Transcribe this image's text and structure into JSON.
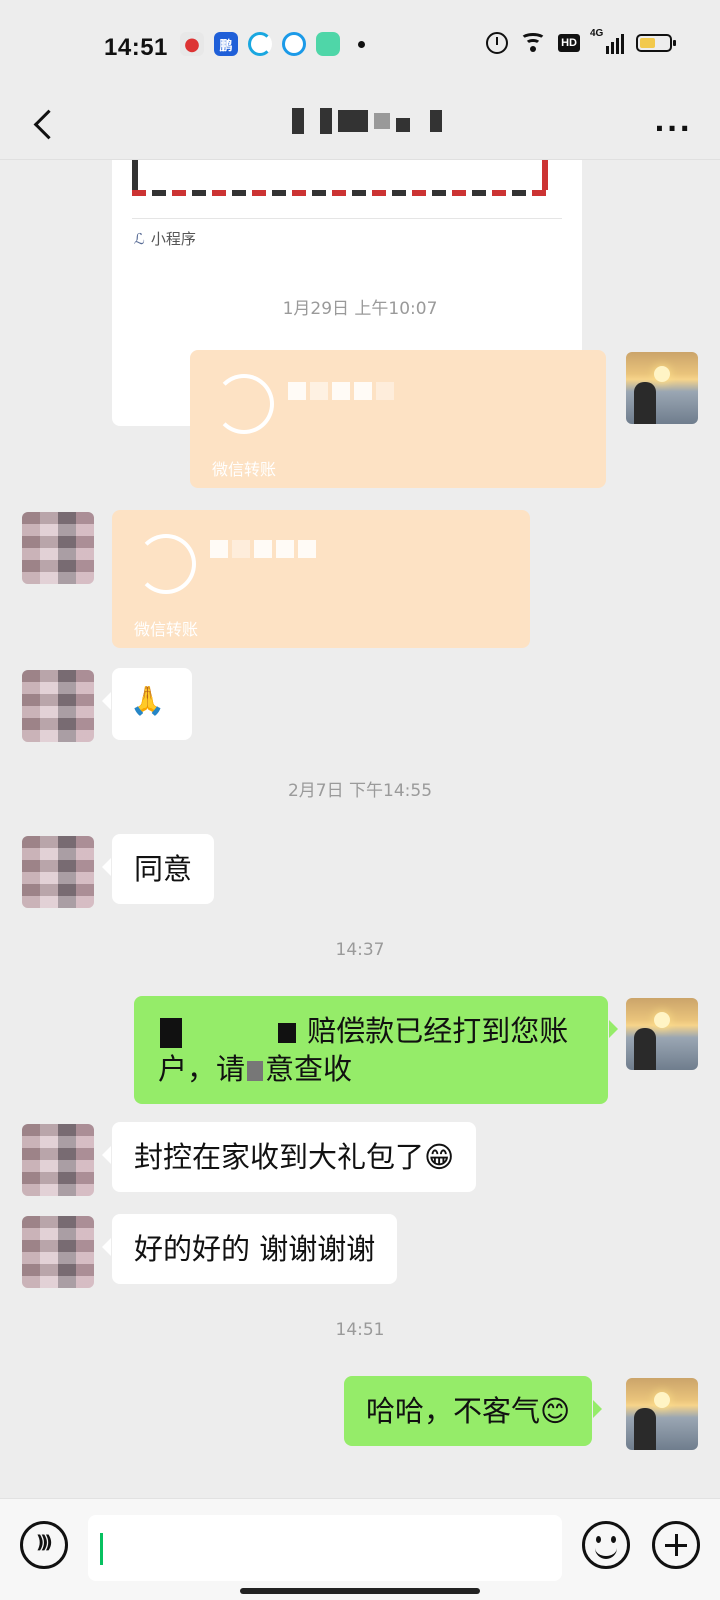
{
  "status_bar": {
    "time": "14:51",
    "network": "4G",
    "hd_label": "HD",
    "battery_level": 0.55
  },
  "header": {
    "back_icon": "chevron-left-icon",
    "more_icon": "more-dots-icon",
    "more_label": "···"
  },
  "mini_program_card": {
    "label": "小程序",
    "icon": "mini-program-icon"
  },
  "messages": [
    {
      "type": "timestamp",
      "text": "1月29日 上午10:07"
    },
    {
      "type": "transfer",
      "side": "right",
      "label": "微信转账"
    },
    {
      "type": "transfer",
      "side": "left",
      "label": "微信转账"
    },
    {
      "type": "emoji",
      "side": "left",
      "text": "🙏"
    },
    {
      "type": "timestamp",
      "text": "2月7日 下午14:55"
    },
    {
      "type": "text",
      "side": "left",
      "text": "同意"
    },
    {
      "type": "timestamp",
      "text": "14:37"
    },
    {
      "type": "text",
      "side": "right",
      "line1": "赔偿款已经打到您账",
      "line2_a": "户，请",
      "line2_b": "意查收"
    },
    {
      "type": "text",
      "side": "left",
      "text": "封控在家收到大礼包了😁"
    },
    {
      "type": "text",
      "side": "left",
      "text": "好的好的 谢谢谢谢"
    },
    {
      "type": "timestamp",
      "text": "14:51"
    },
    {
      "type": "text",
      "side": "right",
      "text": "哈哈，不客气😊"
    }
  ],
  "input_bar": {
    "voice_icon": "voice-icon",
    "emoji_icon": "emoji-icon",
    "plus_icon": "plus-icon",
    "value": ""
  },
  "colors": {
    "background": "#ededed",
    "green_bubble": "#95ec69",
    "transfer_bubble": "#fde2c4",
    "caret": "#07c160"
  }
}
